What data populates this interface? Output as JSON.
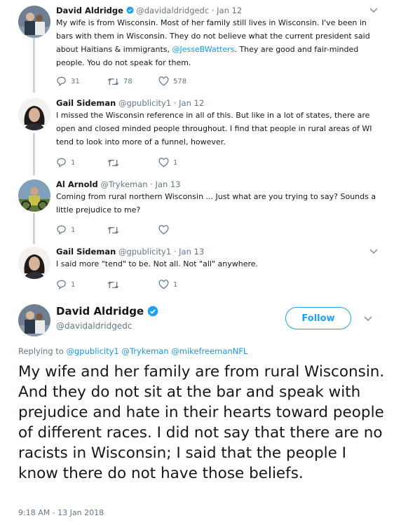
{
  "tweets": [
    {
      "name": "David Aldridge",
      "verified": true,
      "handle": "@davidaldridgedc",
      "date": "Jan 12",
      "text_before": "My wife is from Wisconsin. Most of her family still lives in Wisconsin. I've been in bars with them in Wisconsin. They do not believe what the current president said about Haitians & immigrants, ",
      "mention": "@JesseBWatters",
      "text_after": ". They are good and fair-minded people. You do not speak for them.",
      "replies": "31",
      "retweets": "78",
      "likes": "578"
    },
    {
      "name": "Gail Sideman",
      "handle": "@gpublicity1",
      "date": "Jan 12",
      "text": "I missed the Wisconsin reference in all of this. But like in a lot of states, there are open and closed minded people throughout. I find that people in rural areas of WI tend to look into more of a funnel, however.",
      "replies": "1",
      "retweets": "",
      "likes": "1"
    },
    {
      "name": "Al Arnold",
      "handle": "@Trykeman",
      "date": "Jan 13",
      "text": "Coming from rural northern Wisconsin ... Just what are you trying to say? Sounds a little prejudice to me?",
      "replies": "1",
      "retweets": "",
      "likes": ""
    },
    {
      "name": "Gail Sideman",
      "handle": "@gpublicity1",
      "date": "Jan 13",
      "text": "I said more \"tend\" to be. Not all. Not \"all\" anywhere.",
      "replies": "1",
      "retweets": "",
      "likes": "1"
    }
  ],
  "main_tweet": {
    "name": "David Aldridge",
    "handle": "@davidaldridgedc",
    "follow_label": "Follow",
    "replying_prefix": "Replying to",
    "replying_to": "@gpublicity1 @Trykeman @mikefreemanNFL",
    "text": "My wife and her family are from rural Wisconsin. And they do not sit at the bar and speak with prejudice and hate in their hearts toward people of different races. I did not say that there are no racists in Wisconsin; I said that the people I know there do not have those beliefs.",
    "timestamp": "9:18 AM - 13 Jan 2018"
  },
  "colors": {
    "accent": "#1da1f2",
    "mention": "#1b95e0",
    "secondary_text": "#657786",
    "thread_line": "#ccd6dd"
  },
  "icons": {
    "reply": "reply-icon",
    "retweet": "retweet-icon",
    "like": "heart-icon",
    "more": "chevron-down-icon",
    "verified": "verified-badge-icon"
  }
}
